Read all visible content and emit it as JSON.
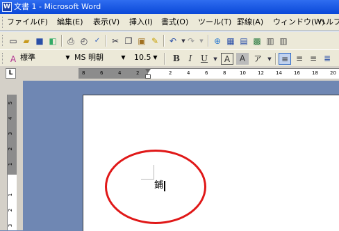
{
  "window": {
    "title": "文書 1 - Microsoft Word",
    "app_icon": "W"
  },
  "menu": [
    "ファイル(F)",
    "編集(E)",
    "表示(V)",
    "挿入(I)",
    "書式(O)",
    "ツール(T)",
    "罫線(A)",
    "ウィンドウ(W)",
    "ヘルプ"
  ],
  "formatting": {
    "style": "標準",
    "font": "MS 明朝",
    "size": "10.5",
    "bold": "B",
    "italic": "I",
    "underline": "U",
    "char_border": "A",
    "char_shading": "A",
    "phonetic": "ア"
  },
  "ruler": {
    "corner": "L",
    "h_ticks": [
      "8",
      "6",
      "4",
      "2",
      "2",
      "4",
      "6",
      "8",
      "10",
      "12",
      "14",
      "16",
      "18",
      "20"
    ],
    "v_ticks": [
      "5",
      "4",
      "3",
      "2",
      "1",
      "1",
      "2",
      "3"
    ]
  },
  "document": {
    "text": "鋪"
  }
}
